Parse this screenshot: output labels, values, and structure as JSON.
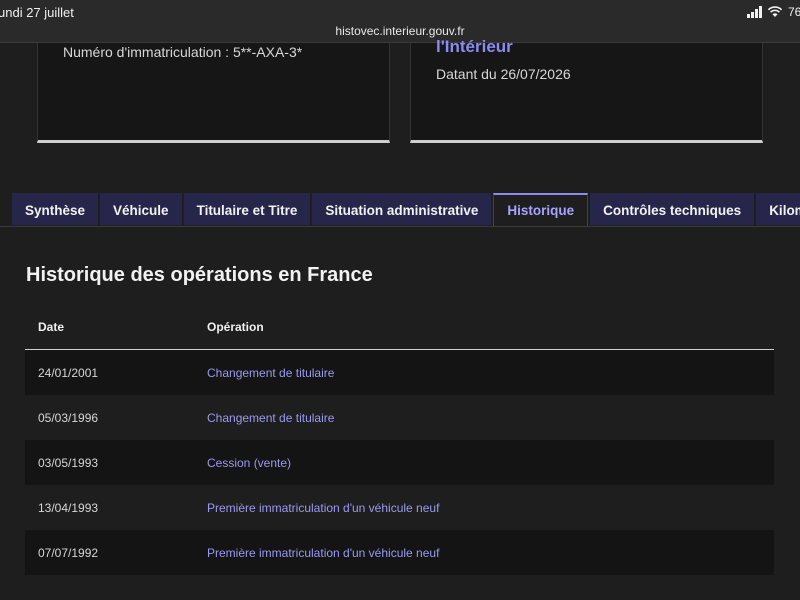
{
  "status": {
    "time": "undi 27 juillet",
    "url": "histovec.interieur.gouv.fr",
    "battery": "76"
  },
  "cards": {
    "left_text": "Numéro d'immatriculation : 5**-AXA-3*",
    "right_title": "l'Intérieur",
    "right_text": "Datant du 26/07/2026"
  },
  "tabs": [
    {
      "label": "Synthèse",
      "active": false
    },
    {
      "label": "Véhicule",
      "active": false
    },
    {
      "label": "Titulaire et Titre",
      "active": false
    },
    {
      "label": "Situation administrative",
      "active": false
    },
    {
      "label": "Historique",
      "active": true
    },
    {
      "label": "Contrôles techniques",
      "active": false
    },
    {
      "label": "Kilométrage",
      "active": false
    }
  ],
  "history": {
    "title": "Historique des opérations en France",
    "headers": {
      "date": "Date",
      "operation": "Opération"
    },
    "rows": [
      {
        "date": "24/01/2001",
        "operation": "Changement de titulaire"
      },
      {
        "date": "05/03/1996",
        "operation": "Changement de titulaire"
      },
      {
        "date": "03/05/1993",
        "operation": "Cession (vente)"
      },
      {
        "date": "13/04/1993",
        "operation": "Première immatriculation d'un véhicule neuf"
      },
      {
        "date": "07/07/1992",
        "operation": "Première immatriculation d'un véhicule neuf"
      }
    ]
  },
  "colors": {
    "accent": "#8c8cf0",
    "tab_bg": "#26264a",
    "background": "#1e1e1e"
  }
}
